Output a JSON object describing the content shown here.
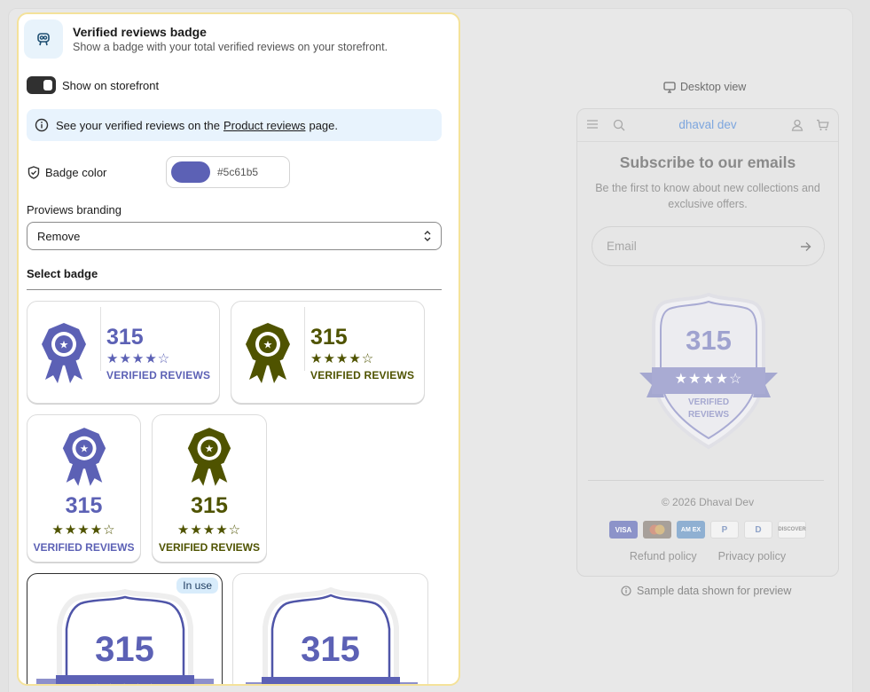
{
  "header": {
    "title": "Verified reviews badge",
    "subtitle": "Show a badge with your total verified reviews on your storefront."
  },
  "storefront_toggle": {
    "label": "Show on storefront",
    "enabled": true
  },
  "info_banner": {
    "text_before": "See your verified reviews on the",
    "link": "Product reviews",
    "text_after": "page."
  },
  "badge_color": {
    "label": "Badge color",
    "value": "#5c61b5"
  },
  "branding": {
    "label": "Proviews branding",
    "value": "Remove"
  },
  "select_badge": {
    "heading": "Select badge",
    "count": "315",
    "stars": "★★★★☆",
    "verified_label": "VERIFIED REVIEWS",
    "in_use_label": "In use",
    "colors": {
      "purple": "#5c61b5",
      "olive": "#4f5300"
    }
  },
  "preview": {
    "view_label": "Desktop view",
    "store_name": "dhaval dev",
    "subscribe_title": "Subscribe to our emails",
    "subscribe_desc": "Be the first to know about new collections and exclusive offers.",
    "email_placeholder": "Email",
    "badge_count": "315",
    "badge_verified_line1": "VERIFIED",
    "badge_verified_line2": "REVIEWS",
    "copyright": "© 2026 Dhaval Dev",
    "payment_methods": [
      "Visa",
      "Mastercard",
      "American Express",
      "PayPal",
      "Diners Club",
      "Discover"
    ],
    "payment_labels": {
      "visa": "VISA",
      "amex": "AM EX",
      "paypal": "P",
      "diners": "D",
      "discover": "DISCOVER"
    },
    "policies": [
      "Refund policy",
      "Privacy policy"
    ],
    "sample_note": "Sample data shown for preview"
  }
}
